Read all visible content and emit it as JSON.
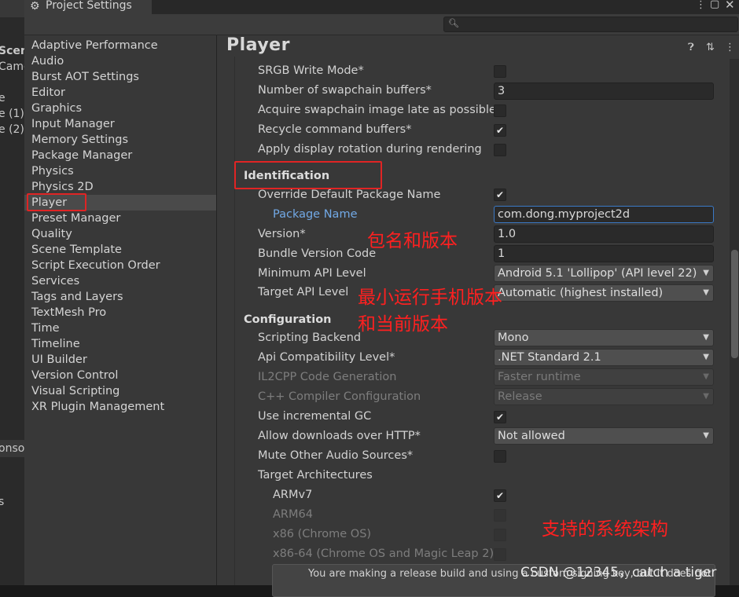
{
  "window": {
    "tab_title": "Project Settings",
    "search_placeholder": ""
  },
  "background_editor": {
    "labels": [
      "Scen",
      "Came",
      "e",
      "e (1)",
      "e (2)",
      "onso",
      "s"
    ]
  },
  "sidebar": {
    "items": [
      {
        "label": "Adaptive Performance"
      },
      {
        "label": "Audio"
      },
      {
        "label": "Burst AOT Settings"
      },
      {
        "label": "Editor"
      },
      {
        "label": "Graphics"
      },
      {
        "label": "Input Manager"
      },
      {
        "label": "Memory Settings"
      },
      {
        "label": "Package Manager"
      },
      {
        "label": "Physics"
      },
      {
        "label": "Physics 2D"
      },
      {
        "label": "Player"
      },
      {
        "label": "Preset Manager"
      },
      {
        "label": "Quality"
      },
      {
        "label": "Scene Template"
      },
      {
        "label": "Script Execution Order"
      },
      {
        "label": "Services"
      },
      {
        "label": "Tags and Layers"
      },
      {
        "label": "TextMesh Pro"
      },
      {
        "label": "Time"
      },
      {
        "label": "Timeline"
      },
      {
        "label": "UI Builder"
      },
      {
        "label": "Version Control"
      },
      {
        "label": "Visual Scripting"
      },
      {
        "label": "XR Plugin Management"
      }
    ],
    "selected": "Player"
  },
  "page": {
    "title": "Player"
  },
  "settings": {
    "srgb_label": "SRGB Write Mode*",
    "swapchain_label": "Number of swapchain buffers*",
    "swapchain_value": "3",
    "acquire_label": "Acquire swapchain image late as possible",
    "recycle_label": "Recycle command buffers*",
    "apply_rotation_label": "Apply display rotation during rendering",
    "identification_header": "Identification",
    "override_pkg_label": "Override Default Package Name",
    "package_name_label": "Package Name",
    "package_name_value": "com.dong.myproject2d",
    "version_label": "Version*",
    "version_value": "1.0",
    "bundle_code_label": "Bundle Version Code",
    "bundle_code_value": "1",
    "min_api_label": "Minimum API Level",
    "min_api_value": "Android 5.1 'Lollipop' (API level 22)",
    "target_api_label": "Target API Level",
    "target_api_value": "Automatic (highest installed)",
    "configuration_header": "Configuration",
    "scripting_backend_label": "Scripting Backend",
    "scripting_backend_value": "Mono",
    "api_compat_label": "Api Compatibility Level*",
    "api_compat_value": ".NET Standard 2.1",
    "il2cpp_label": "IL2CPP Code Generation",
    "il2cpp_value": "Faster runtime",
    "cpp_compiler_label": "C++ Compiler Configuration",
    "cpp_compiler_value": "Release",
    "incremental_gc_label": "Use incremental GC",
    "allow_http_label": "Allow downloads over HTTP*",
    "allow_http_value": "Not allowed",
    "mute_audio_label": "Mute Other Audio Sources*",
    "target_arch_label": "Target Architectures",
    "armv7_label": "ARMv7",
    "arm64_label": "ARM64",
    "x86_label": "x86 (Chrome OS)",
    "x86_64_label": "x86-64 (Chrome OS and Magic Leap 2)",
    "help_text": "You are making a release build and using a custom signing key, but it does not"
  },
  "checkbox_states": {
    "srgb": false,
    "acquire": false,
    "recycle": true,
    "apply_rotation": false,
    "override_pkg": true,
    "incremental_gc": true,
    "mute_audio": false,
    "armv7": true,
    "arm64": false,
    "x86": false,
    "x86_64": false
  },
  "annotations": {
    "package_version": "包名和版本",
    "min_api_line1": "最小运行手机版本",
    "min_api_line2": "和当前版本",
    "architecture": "支持的系统架构"
  },
  "watermark": "CSDN @12345，catch a tiger",
  "colors": {
    "annotation": "#ff2020",
    "highlight_box": "#e02424",
    "package_name_label": "#72a9e6",
    "focus_border": "#3b79c6"
  },
  "icons": [
    "gear-icon",
    "kebab-menu-icon",
    "maximize-icon",
    "close-icon",
    "search-icon",
    "help-icon",
    "preset-icon",
    "kebab-menu-icon"
  ]
}
